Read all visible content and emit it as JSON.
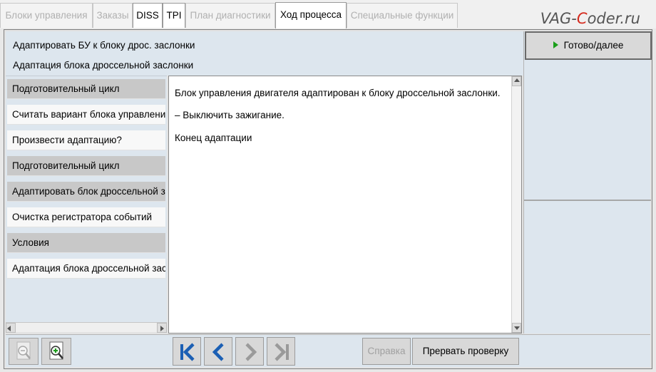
{
  "tabs": [
    {
      "label": "Блоки управления",
      "state": "disabled"
    },
    {
      "label": "Заказы",
      "state": "disabled"
    },
    {
      "label": "DISS",
      "state": "enabled"
    },
    {
      "label": "TPI",
      "state": "enabled"
    },
    {
      "label": "План диагностики",
      "state": "disabled"
    },
    {
      "label": "Ход процесса",
      "state": "active"
    },
    {
      "label": "Специальные функции",
      "state": "disabled"
    }
  ],
  "watermark": {
    "part1": "VAG-",
    "part2": "C",
    "part3": "oder.ru"
  },
  "header": {
    "line1": "Адаптировать БУ к блоку дрос. заслонки",
    "line2": "Адаптация блока дроссельной заслонки"
  },
  "steps": [
    {
      "label": "Подготовительный цикл",
      "style": "grey"
    },
    {
      "label": "Считать вариант блока управления",
      "style": "white"
    },
    {
      "label": "Произвести адаптацию?",
      "style": "white"
    },
    {
      "label": "Подготовительный цикл",
      "style": "grey"
    },
    {
      "label": "Адаптировать блок дроссельной заслонки",
      "style": "grey"
    },
    {
      "label": "Очистка регистратора событий",
      "style": "white"
    },
    {
      "label": "Условия",
      "style": "grey"
    },
    {
      "label": "Адаптация блока дроссельной заслонки",
      "style": "white"
    }
  ],
  "message": {
    "line1": "Блок управления двигателя адаптирован к блоку дроссельной заслонки.",
    "line2": "– Выключить зажигание.",
    "line3": "Конец адаптации"
  },
  "buttons": {
    "done": "Готово/далее",
    "help": "Справка",
    "abort": "Прервать проверку"
  },
  "icons": {
    "zoom_out": "zoom-out-icon",
    "zoom_in": "zoom-in-icon",
    "first": "skip-to-first-icon",
    "prev": "chevron-left-icon",
    "next": "chevron-right-icon",
    "last": "skip-to-last-icon"
  },
  "colors": {
    "nav_enabled": "#1b5fb4",
    "nav_disabled": "#9a9a9a",
    "play_green": "#1a9e1a",
    "watermark_accent": "#d52b1e"
  }
}
